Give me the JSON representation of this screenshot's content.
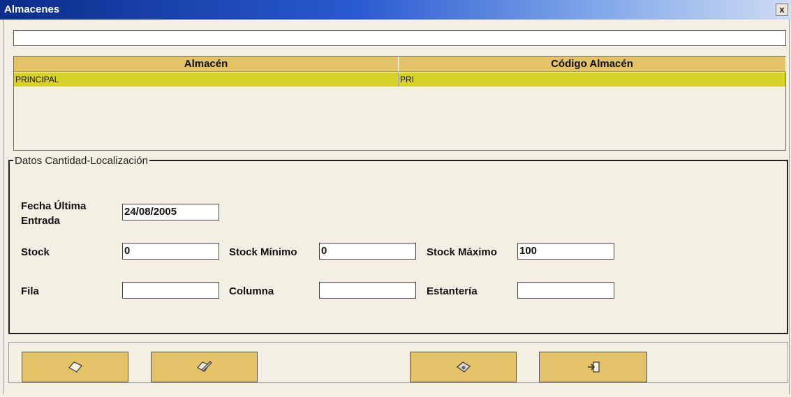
{
  "window": {
    "title": "Almacenes",
    "close_label": "x"
  },
  "search": {
    "value": ""
  },
  "grid": {
    "columns": [
      "Almacén",
      "Código Almacén"
    ],
    "rows": [
      [
        "PRINCIPAL",
        "PRI"
      ]
    ]
  },
  "group": {
    "legend": "Datos Cantidad-Localización",
    "fecha_label_1": "Fecha Última",
    "fecha_label_2": "Entrada",
    "fecha_value": "24/08/2005",
    "stock_label": "Stock",
    "stock_value": "0",
    "stock_min_label": "Stock Mínimo",
    "stock_min_value": "0",
    "stock_max_label": "Stock Máximo",
    "stock_max_value": "100",
    "fila_label": "Fila",
    "fila_value": "",
    "columna_label": "Columna",
    "columna_value": "",
    "estanteria_label": "Estantería",
    "estanteria_value": ""
  },
  "toolbar": {
    "buttons": [
      "new-icon",
      "edit-icon",
      "save-icon",
      "exit-icon"
    ]
  },
  "colors": {
    "title_gradient_start": "#0a2d8a",
    "header_bg": "#e3c268",
    "selected_row": "#d6d22a",
    "window_bg": "#f3efe2"
  }
}
